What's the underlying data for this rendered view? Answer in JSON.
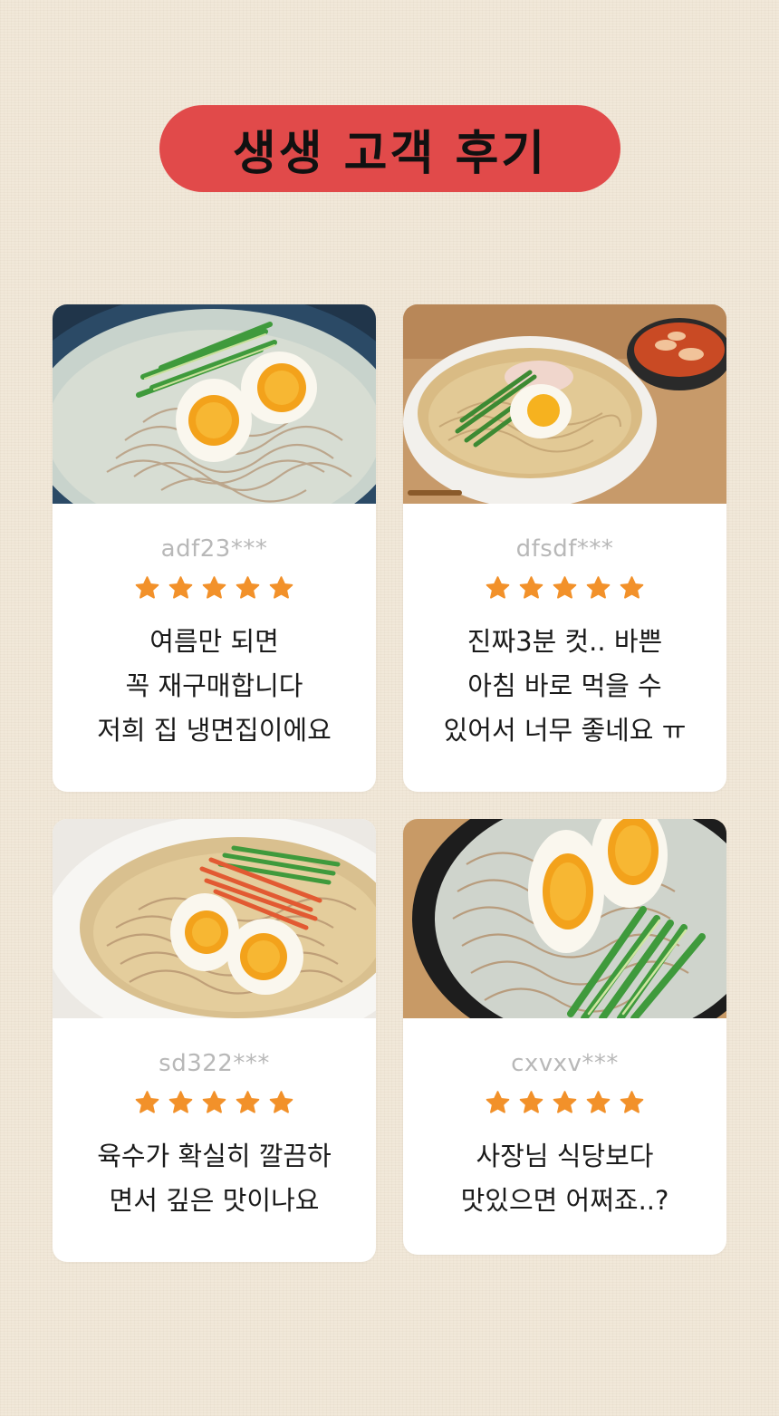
{
  "title": "생생 고객 후기",
  "colors": {
    "title_bg": "#e14a4a",
    "star": "#f2912a",
    "username": "#b8b8b8",
    "background": "#f1e8d9"
  },
  "reviews": [
    {
      "user": "adf23***",
      "rating": 5,
      "lines": [
        "여름만 되면",
        "꼭 재구매합니다",
        "저희 집 냉면집이에요"
      ],
      "photo": "naengmyeon-bowl-photo"
    },
    {
      "user": "dfsdf***",
      "rating": 5,
      "lines": [
        "진짜3분 컷..  바쁜",
        "아침 바로 먹을 수",
        "있어서 너무 좋네요 ㅠ"
      ],
      "photo": "naengmyeon-with-kimchi-photo"
    },
    {
      "user": "sd322***",
      "rating": 5,
      "lines": [
        "육수가 확실히 깔끔하",
        "면서 깊은 맛이나요"
      ],
      "photo": "naengmyeon-white-bowl-photo"
    },
    {
      "user": "cxvxv***",
      "rating": 5,
      "lines": [
        "사장님 식당보다",
        "맛있으면 어쩌죠..?"
      ],
      "photo": "naengmyeon-closeup-photo"
    }
  ]
}
